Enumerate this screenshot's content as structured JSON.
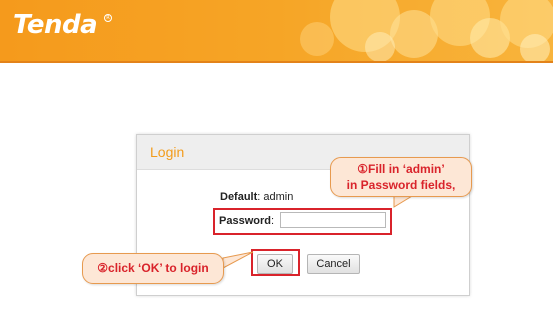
{
  "brand": {
    "logo_text": "Tenda",
    "reg_mark": "R"
  },
  "dialog": {
    "title": "Login",
    "default_label": "Default",
    "default_value": ": admin",
    "password_label": "Password",
    "password_colon": ":",
    "password_value": "",
    "ok_label": "OK",
    "cancel_label": "Cancel"
  },
  "annotations": {
    "step1_line1": "①Fill in ‘admin’",
    "step1_line2": "in Password fields,",
    "step2": "②click ‘OK’ to login"
  },
  "colors": {
    "brand_orange": "#f59a1c",
    "title_orange": "#f39c1c",
    "highlight_red": "#d9232b",
    "callout_fill": "#fde7d6",
    "callout_border": "#e79a4f"
  }
}
